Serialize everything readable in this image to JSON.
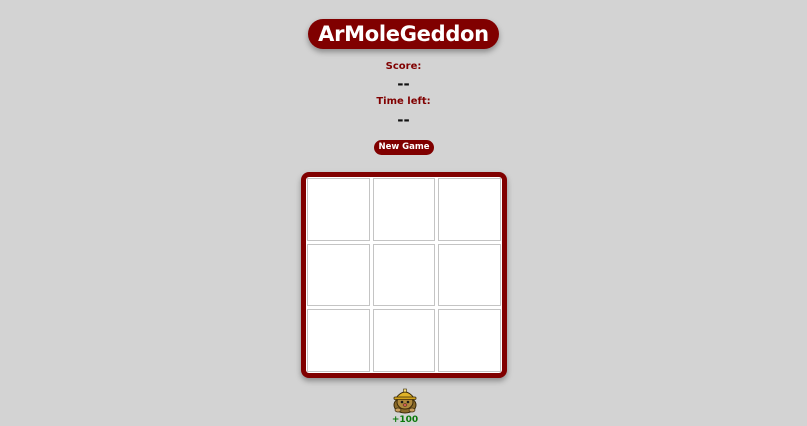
{
  "game": {
    "title": "ArMoleGeddon",
    "score_label": "Score:",
    "score_value": "--",
    "time_label": "Time left:",
    "time_value": "--",
    "new_game_label": "New Game",
    "bonus_text": "+100"
  },
  "board": {
    "rows": 3,
    "cols": 3,
    "holes": [
      "",
      "",
      "",
      "",
      "",
      "",
      "",
      "",
      ""
    ]
  },
  "icons": {
    "mole": "mole-with-hardhat-icon"
  },
  "colors": {
    "background": "#d3d3d3",
    "accent": "#800000",
    "cell_background": "#ffffff",
    "bonus_text": "#0a7a0a"
  }
}
